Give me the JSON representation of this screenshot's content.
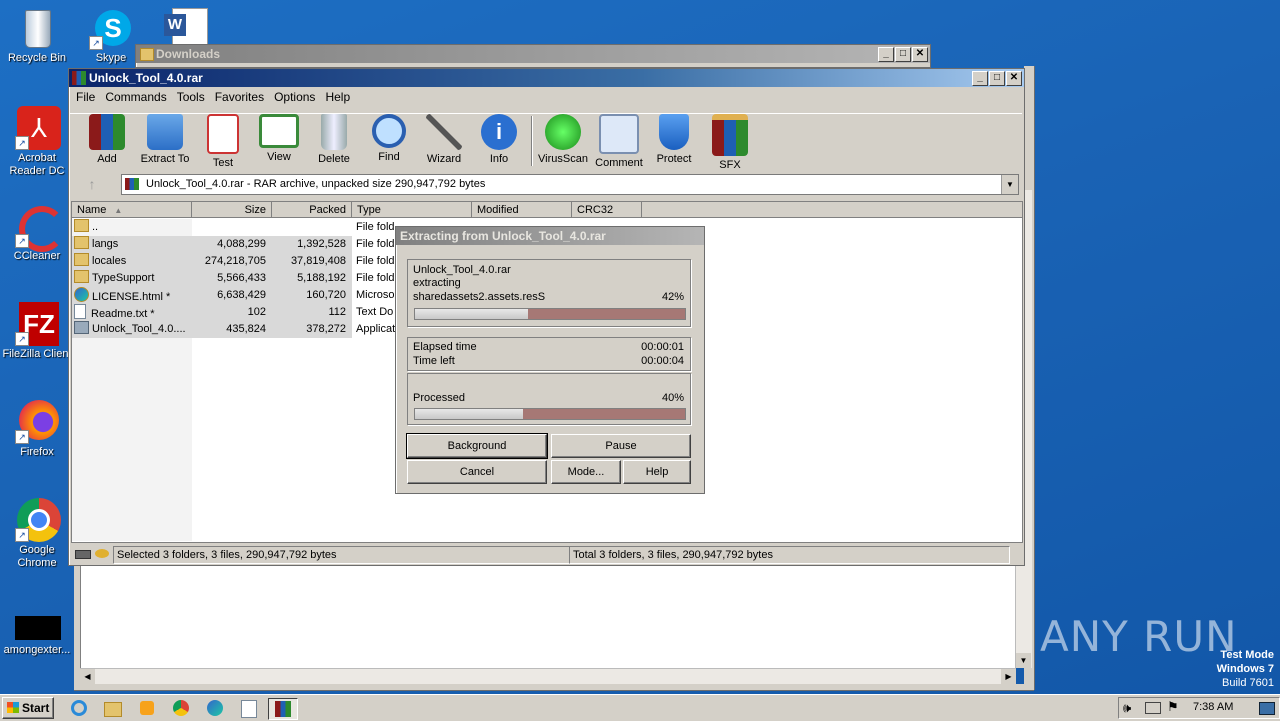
{
  "desktop": {
    "icons": [
      {
        "label": "Recycle Bin"
      },
      {
        "label": "Skype"
      },
      {
        "label": "Acrobat Reader DC"
      },
      {
        "label": "CCleaner"
      },
      {
        "label": "FileZilla Client"
      },
      {
        "label": "Firefox"
      },
      {
        "label": "Google Chrome"
      },
      {
        "label": "amongexter..."
      }
    ]
  },
  "background_window": {
    "title": "Downloads"
  },
  "winrar": {
    "title": "Unlock_Tool_4.0.rar",
    "menu": [
      "File",
      "Commands",
      "Tools",
      "Favorites",
      "Options",
      "Help"
    ],
    "toolbar": [
      {
        "label": "Add",
        "icon": "add-archive-icon"
      },
      {
        "label": "Extract To",
        "icon": "extract-folder-icon"
      },
      {
        "label": "Test",
        "icon": "test-clipboard-icon"
      },
      {
        "label": "View",
        "icon": "view-book-icon"
      },
      {
        "label": "Delete",
        "icon": "trash-icon"
      },
      {
        "label": "Find",
        "icon": "magnifier-icon"
      },
      {
        "label": "Wizard",
        "icon": "wand-icon"
      },
      {
        "label": "Info",
        "icon": "info-icon"
      },
      {
        "label": "VirusScan",
        "icon": "bug-icon"
      },
      {
        "label": "Comment",
        "icon": "comment-icon"
      },
      {
        "label": "Protect",
        "icon": "shield-icon"
      },
      {
        "label": "SFX",
        "icon": "sfx-box-icon"
      }
    ],
    "address": "Unlock_Tool_4.0.rar - RAR archive, unpacked size 290,947,792 bytes",
    "columns": [
      "Name",
      "Size",
      "Packed",
      "Type",
      "Modified",
      "CRC32"
    ],
    "files": [
      {
        "name": "..",
        "size": "",
        "packed": "",
        "type": "File fold",
        "icon": "folder-up-icon"
      },
      {
        "name": "langs",
        "size": "4,088,299",
        "packed": "1,392,528",
        "type": "File fold",
        "icon": "folder-icon"
      },
      {
        "name": "locales",
        "size": "274,218,705",
        "packed": "37,819,408",
        "type": "File fold",
        "icon": "folder-icon"
      },
      {
        "name": "TypeSupport",
        "size": "5,566,433",
        "packed": "5,188,192",
        "type": "File fold",
        "icon": "folder-icon"
      },
      {
        "name": "LICENSE.html *",
        "size": "6,638,429",
        "packed": "160,720",
        "type": "Microso",
        "icon": "edge-file-icon"
      },
      {
        "name": "Readme.txt *",
        "size": "102",
        "packed": "112",
        "type": "Text Do",
        "icon": "text-file-icon"
      },
      {
        "name": "Unlock_Tool_4.0....",
        "size": "435,824",
        "packed": "378,272",
        "type": "Applicat",
        "icon": "app-file-icon"
      }
    ],
    "status_left": "Selected 3 folders, 3 files, 290,947,792 bytes",
    "status_right": "Total 3 folders, 3 files, 290,947,792 bytes"
  },
  "dialog": {
    "title": "Extracting from Unlock_Tool_4.0.rar",
    "archive": "Unlock_Tool_4.0.rar",
    "action": "extracting",
    "current_file": "sharedassets2.assets.resS",
    "file_percent_label": "42%",
    "file_progress": 0.42,
    "elapsed_label": "Elapsed time",
    "elapsed": "00:00:01",
    "left_label": "Time left",
    "left": "00:00:04",
    "processed_label": "Processed",
    "processed_percent_label": "40%",
    "processed_progress": 0.4,
    "buttons": {
      "background": "Background",
      "pause": "Pause",
      "cancel": "Cancel",
      "mode": "Mode...",
      "help": "Help"
    }
  },
  "watermark": {
    "brand": "ANY RUN",
    "test_mode": "Test Mode",
    "os": "Windows 7",
    "build": "Build 7601"
  },
  "taskbar": {
    "start": "Start",
    "clock": "7:38 AM"
  }
}
